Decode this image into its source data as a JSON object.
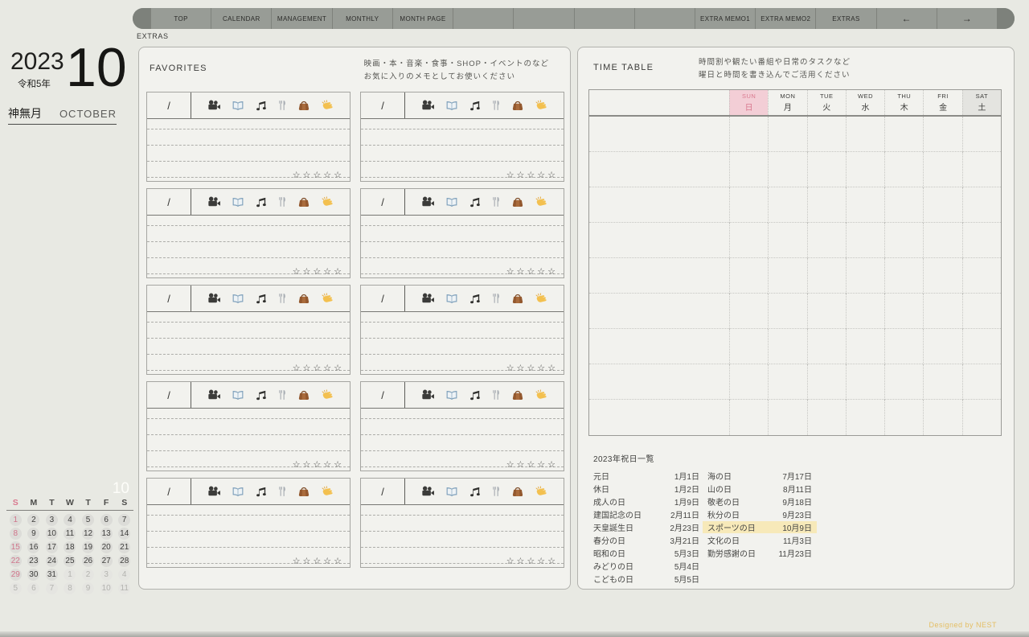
{
  "nav": {
    "tabs": [
      "TOP",
      "CALENDAR",
      "MANAGEMENT",
      "MONTHLY",
      "MONTH PAGE",
      "",
      "",
      "",
      "",
      "EXTRA MEMO1",
      "EXTRA MEMO2",
      "EXTRAS",
      "←",
      "→"
    ],
    "active_page_label": "EXTRAS"
  },
  "date_header": {
    "year": "2023",
    "era": "令和5年",
    "month_number": "10",
    "month_jp": "神無月",
    "month_en": "OCTOBER"
  },
  "mini_calendar": {
    "month_label": "10",
    "weekday_headers": [
      "S",
      "M",
      "T",
      "W",
      "T",
      "F",
      "S"
    ],
    "weeks": [
      [
        {
          "d": "1",
          "t": "sun"
        },
        {
          "d": "2",
          "t": "cur"
        },
        {
          "d": "3",
          "t": "cur"
        },
        {
          "d": "4",
          "t": "cur"
        },
        {
          "d": "5",
          "t": "cur"
        },
        {
          "d": "6",
          "t": "cur"
        },
        {
          "d": "7",
          "t": "cur"
        }
      ],
      [
        {
          "d": "8",
          "t": "sun"
        },
        {
          "d": "9",
          "t": "cur"
        },
        {
          "d": "10",
          "t": "cur"
        },
        {
          "d": "11",
          "t": "cur"
        },
        {
          "d": "12",
          "t": "cur"
        },
        {
          "d": "13",
          "t": "cur"
        },
        {
          "d": "14",
          "t": "cur"
        }
      ],
      [
        {
          "d": "15",
          "t": "sun"
        },
        {
          "d": "16",
          "t": "cur"
        },
        {
          "d": "17",
          "t": "cur"
        },
        {
          "d": "18",
          "t": "cur"
        },
        {
          "d": "19",
          "t": "cur"
        },
        {
          "d": "20",
          "t": "cur"
        },
        {
          "d": "21",
          "t": "cur"
        }
      ],
      [
        {
          "d": "22",
          "t": "sun"
        },
        {
          "d": "23",
          "t": "cur"
        },
        {
          "d": "24",
          "t": "cur"
        },
        {
          "d": "25",
          "t": "cur"
        },
        {
          "d": "26",
          "t": "cur"
        },
        {
          "d": "27",
          "t": "cur"
        },
        {
          "d": "28",
          "t": "cur"
        }
      ],
      [
        {
          "d": "29",
          "t": "sun"
        },
        {
          "d": "30",
          "t": "cur"
        },
        {
          "d": "31",
          "t": "cur"
        },
        {
          "d": "1",
          "t": "next"
        },
        {
          "d": "2",
          "t": "next"
        },
        {
          "d": "3",
          "t": "next"
        },
        {
          "d": "4",
          "t": "next"
        }
      ],
      [
        {
          "d": "5",
          "t": "next"
        },
        {
          "d": "6",
          "t": "next"
        },
        {
          "d": "7",
          "t": "next"
        },
        {
          "d": "8",
          "t": "next"
        },
        {
          "d": "9",
          "t": "next"
        },
        {
          "d": "10",
          "t": "next"
        },
        {
          "d": "11",
          "t": "next"
        }
      ]
    ]
  },
  "favorites": {
    "title": "FAVORITES",
    "note_line1": "映画・本・音楽・食事・SHOP・イベントのなど",
    "note_line2": "お気に入りのメモとしてお使いください",
    "cards_count": 10,
    "card": {
      "date_placeholder": "/",
      "icons": [
        "movie-camera-icon",
        "open-book-icon",
        "musical-notes-icon",
        "fork-knife-icon",
        "handbag-icon",
        "clapping-hands-icon"
      ],
      "stars": "☆☆☆☆☆"
    }
  },
  "timetable": {
    "title": "TIME TABLE",
    "note_line1": "時間割や観たい番組や日常のタスクなど",
    "note_line2": "曜日と時間を書き込んでご活用ください",
    "columns": [
      {
        "en": "SUN",
        "jp": "日",
        "type": "sun"
      },
      {
        "en": "MON",
        "jp": "月",
        "type": "weekday"
      },
      {
        "en": "TUE",
        "jp": "火",
        "type": "weekday"
      },
      {
        "en": "WED",
        "jp": "水",
        "type": "weekday"
      },
      {
        "en": "THU",
        "jp": "木",
        "type": "weekday"
      },
      {
        "en": "FRI",
        "jp": "金",
        "type": "weekday"
      },
      {
        "en": "SAT",
        "jp": "土",
        "type": "sat"
      }
    ],
    "body_rows": 9
  },
  "holidays": {
    "title": "2023年祝日一覧",
    "left": [
      {
        "name": "元日",
        "date": "1月1日"
      },
      {
        "name": "休日",
        "date": "1月2日"
      },
      {
        "name": "成人の日",
        "date": "1月9日"
      },
      {
        "name": "建国記念の日",
        "date": "2月11日"
      },
      {
        "name": "天皇誕生日",
        "date": "2月23日"
      },
      {
        "name": "春分の日",
        "date": "3月21日"
      },
      {
        "name": "昭和の日",
        "date": "5月3日"
      },
      {
        "name": "みどりの日",
        "date": "5月4日"
      },
      {
        "name": "こどもの日",
        "date": "5月5日"
      }
    ],
    "right": [
      {
        "name": "海の日",
        "date": "7月17日"
      },
      {
        "name": "山の日",
        "date": "8月11日"
      },
      {
        "name": "敬老の日",
        "date": "9月18日"
      },
      {
        "name": "秋分の日",
        "date": "9月23日"
      },
      {
        "name": "スポーツの日",
        "date": "10月9日",
        "highlight": true
      },
      {
        "name": "文化の日",
        "date": "11月3日"
      },
      {
        "name": "勤労感謝の日",
        "date": "11月23日"
      }
    ]
  },
  "footer": {
    "credit": "Designed by NEST"
  },
  "colors": {
    "accent_pink": "#d9798f",
    "sun_header_bg": "#f3ced6",
    "sat_header_bg": "#e4e4e0",
    "holiday_highlight": "#f7e9b9",
    "credit_gold": "#e4be63",
    "nav_bar": "#989c96"
  }
}
